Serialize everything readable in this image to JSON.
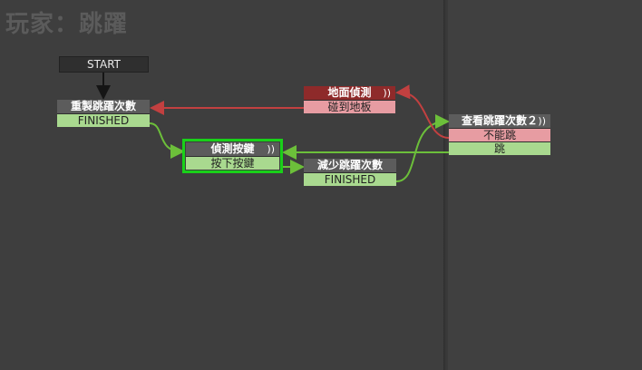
{
  "title": "玩家：跳躍",
  "start_label": "START",
  "colors": {
    "transition_green": "#6cbf3a",
    "transition_red": "#c24040",
    "selected": "#19d019",
    "header_red": "#8e2a2a"
  },
  "nodes": {
    "reset": {
      "name": "重製跳躍次數",
      "events": [
        "FINISHED"
      ]
    },
    "detect_key": {
      "name": "偵測按鍵",
      "events": [
        "按下按鍵"
      ],
      "wave": "))"
    },
    "reduce": {
      "name": "減少跳躍次數",
      "events": [
        "FINISHED"
      ]
    },
    "ground": {
      "name": "地面偵測",
      "events": [
        "碰到地板"
      ],
      "wave": "))"
    },
    "check": {
      "name": "查看跳躍次數２",
      "events": [
        "不能跳",
        "跳"
      ],
      "wave": "))"
    }
  }
}
